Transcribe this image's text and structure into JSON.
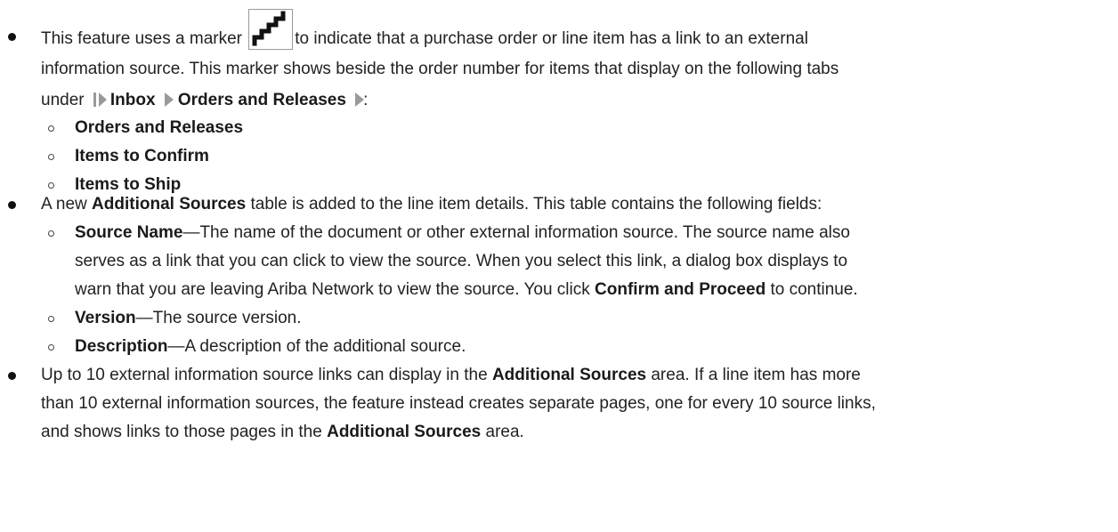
{
  "bullets": {
    "b1": {
      "pre_marker": "This feature uses a marker",
      "post_marker": "to indicate that a purchase order or line item has a link to an external",
      "line2": "information source. This marker shows beside the order number for items that display on the following tabs",
      "under": "under",
      "nav_inbox": "Inbox",
      "nav_orders": "Orders and Releases",
      "colon": ":",
      "subs": [
        "Orders and Releases",
        "Items to Confirm",
        "Items to Ship"
      ]
    },
    "b2": {
      "pre": "A new",
      "bold": "Additional Sources",
      "post": "table is added to the line item details. This table contains the following fields:",
      "source_name": {
        "bold": "Source Name",
        "line1": "—The name of the document or other external information source. The source name also",
        "line2": "serves as a link that you can click to view the source. When you select this link, a dialog box displays to",
        "line3_pre": "warn that you are leaving Ariba Network to view the source. You click",
        "line3_bold": "Confirm and Proceed",
        "line3_post": "to continue."
      },
      "version": {
        "bold": "Version",
        "text": "—The source version."
      },
      "description": {
        "bold": "Description",
        "text": "—A description of the additional source."
      }
    },
    "b3": {
      "line1_pre": "Up to 10 external information source links can display in the",
      "line1_bold": "Additional Sources",
      "line1_post": "area. If a line item has more",
      "line2": "than 10 external information sources, the feature instead creates separate pages, one for every 10 source links,",
      "line3_pre": "and shows links to those pages in the",
      "line3_bold": "Additional Sources",
      "line3_post": "area."
    }
  },
  "icons": {
    "marker": "staircase-marker-icon",
    "nav_start": "path-start-icon",
    "nav_sep": "path-separator-icon",
    "bullet": "filled-circle-bullet",
    "sub_bullet": "hollow-circle-bullet"
  },
  "colors": {
    "text": "#222222",
    "icon_gray": "#9a9a9a"
  }
}
